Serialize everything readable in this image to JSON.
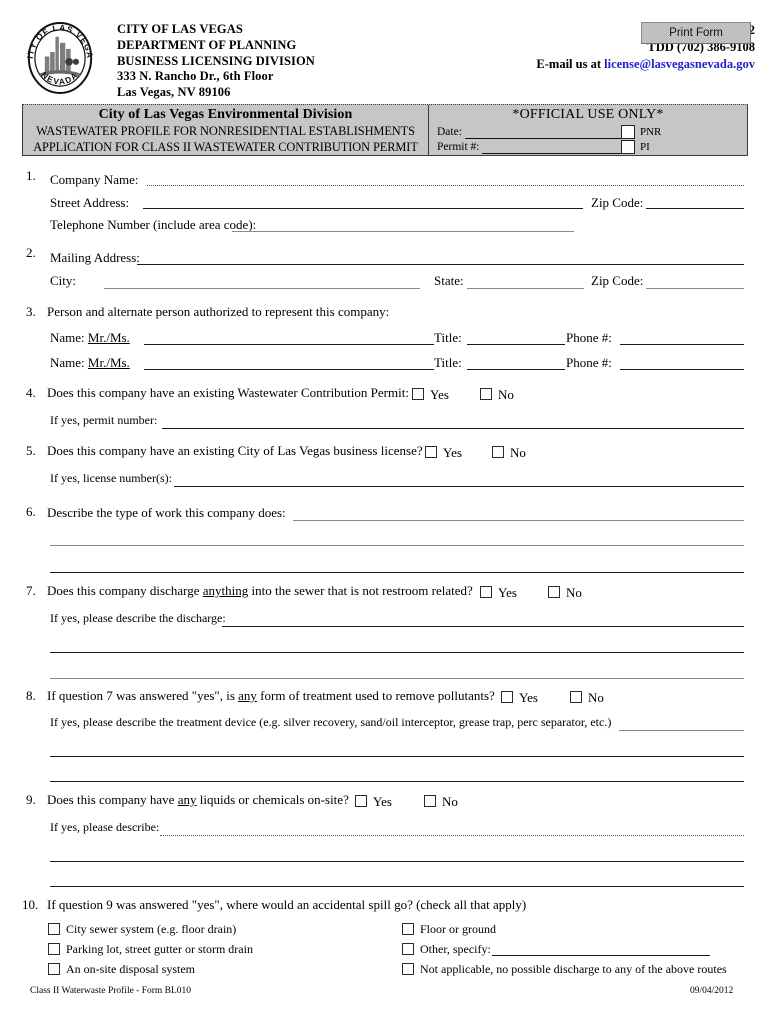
{
  "header": {
    "agency_lines": [
      "CITY OF LAS VEGAS",
      "DEPARTMENT OF PLANNING",
      "BUSINESS LICENSING DIVISION",
      "333 N. Rancho Dr., 6th Floor",
      "Las Vegas, NV 89106"
    ],
    "fax": "Fax (702) 382-6642",
    "tdd": "TDD (702) 386-9108",
    "email_prefix": "E-mail us at ",
    "email": "license@lasvegasnevada.gov",
    "email_color": "#2222cc",
    "print_button": "Print Form",
    "seal": {
      "top_text": "CITY OF LAS VEGAS",
      "bottom_text": "NEVADA"
    }
  },
  "band": {
    "title": "City of Las Vegas Environmental Division",
    "subtitle_1": "WASTEWATER PROFILE FOR NONRESIDENTIAL ESTABLISHMENTS",
    "subtitle_2": "APPLICATION FOR CLASS II WASTEWATER CONTRIBUTION PERMIT",
    "official_use": "*OFFICIAL USE ONLY*",
    "date_label": "Date:",
    "permit_label": "Permit #:",
    "date_value": "",
    "permit_value": "",
    "pnr_label": "PNR",
    "pi_label": "PI",
    "background": "#c6c6c6"
  },
  "questions": {
    "q1": {
      "num": "1.",
      "company_name_label": "Company Name:",
      "street_address_label": "Street Address:",
      "zip_code_label": "Zip Code:",
      "telephone_label": "Telephone Number (include area code):"
    },
    "q2": {
      "num": "2.",
      "mailing_address_label": "Mailing Address:",
      "city_label": "City:",
      "state_label": "State:",
      "zip_code_label": "Zip Code:"
    },
    "q3": {
      "num": "3.",
      "text": "Person and alternate person authorized to represent this company:",
      "name_label": "Name:",
      "name_prefix": "Mr./Ms.",
      "title_label": "Title:",
      "phone_label": "Phone #:"
    },
    "q4": {
      "num": "4.",
      "text": "Does this company have an existing Wastewater Contribution Permit:",
      "yes": "Yes",
      "no": "No",
      "followup": "If yes, permit number:"
    },
    "q5": {
      "num": "5.",
      "text": "Does this company have an existing City of Las Vegas business license?",
      "yes": "Yes",
      "no": "No",
      "followup": "If yes, license number(s):"
    },
    "q6": {
      "num": "6.",
      "text": "Describe the type of work this company does:"
    },
    "q7": {
      "num": "7.",
      "text_a": "Does this company discharge ",
      "text_em": "anything",
      "text_b": " into the sewer that is not restroom related?",
      "yes": "Yes",
      "no": "No",
      "followup": "If yes, please describe the discharge:"
    },
    "q8": {
      "num": "8.",
      "text_a": "If question 7 was answered \"yes\", is ",
      "text_em": "any",
      "text_b": " form of treatment used to remove pollutants?",
      "yes": "Yes",
      "no": "No",
      "followup": "If yes, please describe the treatment device (e.g. silver recovery, sand/oil interceptor, grease trap, perc separator, etc.)"
    },
    "q9": {
      "num": "9.",
      "text_a": "Does this company have ",
      "text_em": "any",
      "text_b": " liquids or chemicals on-site?",
      "yes": "Yes",
      "no": "No",
      "followup": "If yes, please describe:"
    },
    "q10": {
      "num": "10.",
      "text": "If question 9 was answered \"yes\", where would an accidental spill go? (check all that apply)",
      "options_left": [
        "City sewer system (e.g. floor drain)",
        "Parking lot, street gutter or storm drain",
        "An on-site disposal system"
      ],
      "options_right": [
        "Floor or ground",
        "Other, specify:",
        "Not applicable, no possible discharge to any of the above routes"
      ]
    }
  },
  "footer": {
    "form_id": "Class II Waterwaste Profile - Form BL010",
    "date": "09/04/2012"
  }
}
